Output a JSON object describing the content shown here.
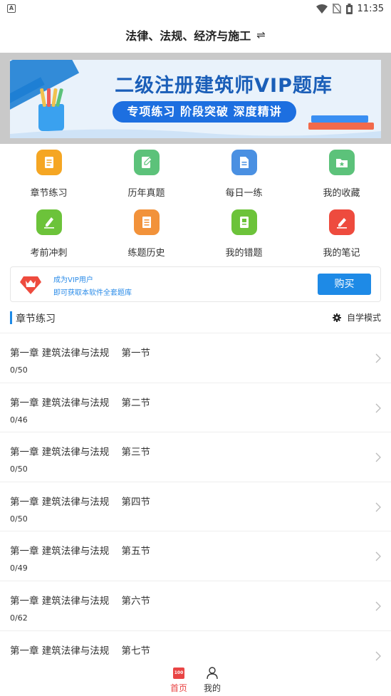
{
  "status_bar": {
    "time": "11:35"
  },
  "header": {
    "title": "法律、法规、经济与施工",
    "swap_symbol": "⇌"
  },
  "banner": {
    "headline": "二级注册建筑师VIP题库",
    "tagline": "专项练习  阶段突破  深度精讲"
  },
  "menu": [
    {
      "label": "章节练习",
      "icon": "chapter-practice-icon",
      "color": "#f5a623"
    },
    {
      "label": "历年真题",
      "icon": "past-exams-icon",
      "color": "#5cc27a"
    },
    {
      "label": "每日一练",
      "icon": "daily-practice-icon",
      "color": "#4a90e2"
    },
    {
      "label": "我的收藏",
      "icon": "favorites-icon",
      "color": "#5cc27a"
    },
    {
      "label": "考前冲刺",
      "icon": "pre-exam-sprint-icon",
      "color": "#6cc33a"
    },
    {
      "label": "练题历史",
      "icon": "practice-history-icon",
      "color": "#f2923a"
    },
    {
      "label": "我的错题",
      "icon": "wrong-questions-icon",
      "color": "#6cc33a"
    },
    {
      "label": "我的笔记",
      "icon": "notes-icon",
      "color": "#ee4b3e"
    }
  ],
  "vip": {
    "line1": "成为VIP用户",
    "line2": "即可获取本软件全套题库",
    "button": "购买"
  },
  "section": {
    "title": "章节练习",
    "mode": "自学模式"
  },
  "chapters": [
    {
      "title": "第一章 建筑法律与法规    第一节",
      "count": "0/50"
    },
    {
      "title": "第一章 建筑法律与法规    第二节",
      "count": "0/46"
    },
    {
      "title": "第一章 建筑法律与法规    第三节",
      "count": "0/50"
    },
    {
      "title": "第一章 建筑法律与法规    第四节",
      "count": "0/50"
    },
    {
      "title": "第一章 建筑法律与法规    第五节",
      "count": "0/49"
    },
    {
      "title": "第一章 建筑法律与法规    第六节",
      "count": "0/62"
    },
    {
      "title": "第一章 建筑法律与法规    第七节",
      "count": ""
    }
  ],
  "bottom_nav": {
    "home": "首页",
    "home_icon_text": "100",
    "mine": "我的"
  },
  "colors": {
    "accent": "#1e8ae6",
    "active_tab": "#e94545"
  }
}
